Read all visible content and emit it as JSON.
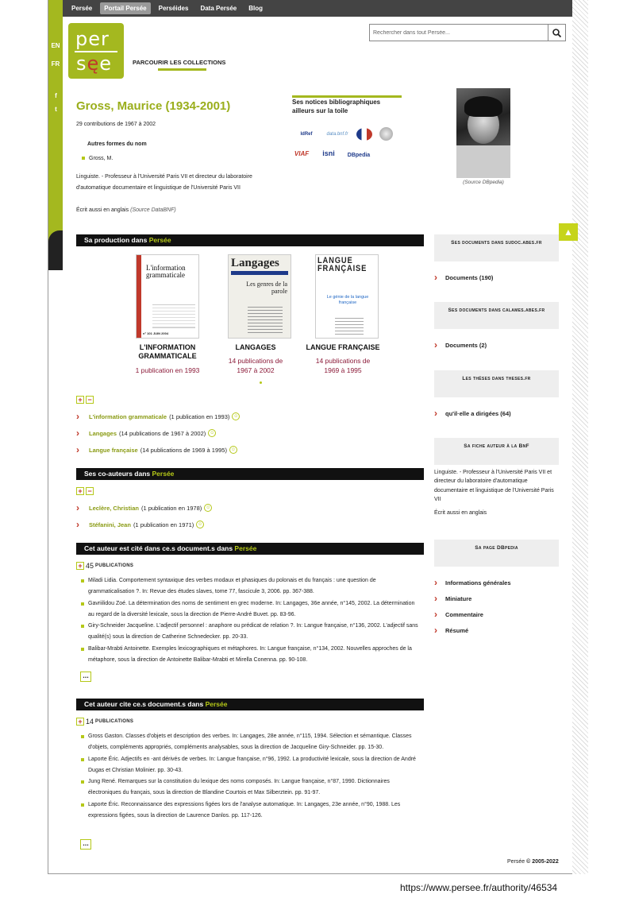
{
  "nav": [
    "Persée",
    "Portail Persée",
    "Perséides",
    "Data Persée",
    "Blog"
  ],
  "nav_active": 1,
  "lang": {
    "en": "EN",
    "fr": "FR"
  },
  "logo": {
    "top": "per",
    "bottom_a": "s",
    "bottom_b": "ę",
    "bottom_c": "e",
    "alt": "persée"
  },
  "browse": "PARCOURIR LES COLLECTIONS",
  "search": {
    "placeholder": "Rechercher dans tout Persée..."
  },
  "author": {
    "name": "Gross, Maurice (1934-2001)",
    "contributions": "29 contributions de 1967 à 2002",
    "alt_forms_title": "Autres formes du nom",
    "alt_forms": [
      "Gross, M."
    ],
    "bio": "Linguiste. - Professeur à l'Université Paris VII et directeur du laboratoire d'automatique documentaire et linguistique de l'Université Paris VII",
    "also_en": "Écrit aussi en anglais",
    "also_en_src": "(Source DataBNF)",
    "photo_caption": "(Source DBpedia)"
  },
  "notices": {
    "title": "Ses notices bibliographiques ailleurs sur la toile",
    "logos": [
      "IdRef",
      "data.bnf.fr",
      "BnF",
      "Wikipedia",
      "VIAF",
      "isni",
      "DBpedia"
    ]
  },
  "production": {
    "title_a": "Sa production dans ",
    "title_b": "Persée",
    "journals": [
      {
        "label": "L'INFORMATION GRAMMATICALE",
        "pubs": "1 publication en 1993"
      },
      {
        "label": "LANGAGES",
        "pubs": "14 publications de 1967 à 2002"
      },
      {
        "label": "LANGUE FRANÇAISE",
        "pubs": "14 publications de 1969 à 1995"
      }
    ],
    "covers": {
      "ig_title": "L'information grammaticale",
      "ig_num": "n° 101  JUIN 2004",
      "lang_title": "Langages",
      "lang_sub": "Les genres de la parole",
      "lf_title": "LANGUE FRANÇAISE",
      "lf_sub": "Le génie de la langue française"
    },
    "list": [
      {
        "link": "L'information grammaticale",
        "rest": "(1 publication en 1993)"
      },
      {
        "link": "Langages",
        "rest": "(14 publications de 1967 à 2002)"
      },
      {
        "link": "Langue française",
        "rest": "(14 publications de 1969 à 1995)"
      }
    ]
  },
  "coauthors": {
    "title_a": "Ses co-auteurs dans ",
    "title_b": "Persée",
    "list": [
      {
        "link": "Leclère, Christian",
        "rest": "(1 publication en 1978)"
      },
      {
        "link": "Stéfanini, Jean",
        "rest": "(1 publication en 1971)"
      }
    ]
  },
  "cited": {
    "title_a": "Cet auteur est cité dans ce.s document.s dans ",
    "title_b": "Persée",
    "count": "45",
    "count_label": "PUBLICATIONS",
    "refs": [
      "Miladi Lidia. Comportement syntaxique des verbes modaux et phasiques du polonais et du français : une question de grammaticalisation ?. In: Revue des études slaves, tome 77, fascicule 3, 2006. pp. 367-388.",
      "Gavriilidou Zoé. La détermination des noms de sentiment en grec moderne. In: Langages, 36e année, n°145, 2002. La détermination au regard de la diversité lexicale, sous la direction de Pierre-André Buvet. pp. 83-96.",
      "Giry-Schneider Jacqueline. L'adjectif personnel : anaphore ou prédicat de relation ?. In: Langue française, n°136, 2002. L'adjectif sans qualité(s) sous la direction de Catherine Schnedecker. pp. 20-33.",
      "Balibar-Mrabti Antoinette. Exemples lexicographiques et métaphores. In: Langue française, n°134, 2002. Nouvelles approches de la métaphore, sous la direction de Antoinette Balibar-Mrabti et Mirella Conenna. pp. 90-108."
    ],
    "more": "..."
  },
  "cites": {
    "title_a": "Cet auteur cite ce.s document.s dans ",
    "title_b": "Persée",
    "count": "14",
    "count_label": "PUBLICATIONS",
    "refs": [
      "Gross Gaston. Classes d'objets et description des verbes. In: Langages, 28e année, n°115, 1994. Sélection et sémantique. Classes d'objets, compléments appropriés, compléments analysables, sous la direction de Jacqueline Giry-Schneider. pp. 15-30.",
      "Laporte Éric. Adjectifs en -ant dérivés de verbes. In: Langue française, n°96, 1992. La productivité lexicale, sous la direction de André Dugas et Christian Molinier. pp. 30-43.",
      "Jung René. Remarques sur la constitution du lexique des noms composés. In: Langue française, n°87, 1990. Dictionnaires électroniques du français, sous la direction de Blandine Courtois et Max Silberztein. pp. 91-97.",
      "Laporte Éric. Reconnaissance des expressions figées lors de l'analyse automatique. In: Langages, 23e année, n°90, 1988. Les expressions figées, sous la direction de Laurence Danlos. pp. 117-126."
    ],
    "more": "..."
  },
  "side": {
    "sudoc": {
      "title": "Ses documents dans sudoc.abes.fr",
      "link": "Documents (190)"
    },
    "calames": {
      "title": "Ses documents dans calames.abes.fr",
      "link": "Documents (2)"
    },
    "theses": {
      "title": "Les thèses dans theses.fr",
      "link": "qu'il·elle a dirigées (64)"
    },
    "bnf": {
      "title": "Sa fiche auteur à la BnF",
      "bio": "Linguiste. - Professeur à l'Université Paris VII et directeur du laboratoire d'automatique documentaire et linguistique de l'Université Paris VII",
      "also_en": "Écrit aussi en anglais"
    },
    "dbpedia": {
      "title": "Sa page DBpedia",
      "links": [
        "Informations générales",
        "Miniature",
        "Commentaire",
        "Résumé"
      ]
    }
  },
  "footer": {
    "a": "Persée",
    "b": "© 2005-2022"
  },
  "url": "https://www.persee.fr/authority/46534",
  "colors": {
    "accent": "#a4b81f",
    "link_red": "#8b1a38",
    "nav_bg": "#444444"
  }
}
